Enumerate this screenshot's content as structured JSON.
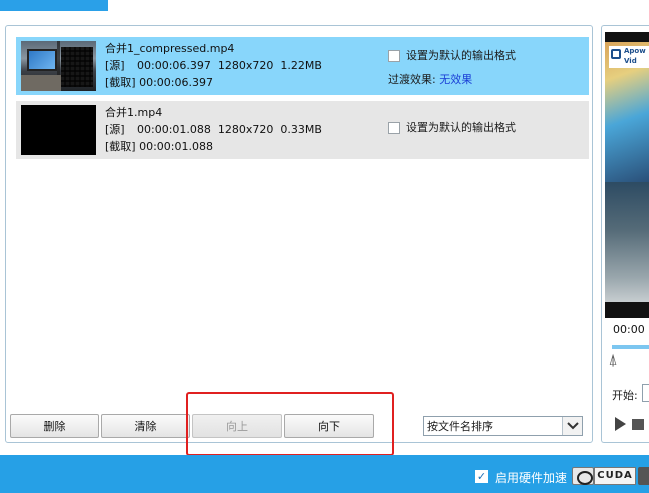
{
  "files": [
    {
      "name": "合并1_compressed.mp4",
      "source_label": "[源]",
      "source_duration": "00:00:06.397",
      "resolution": "1280x720",
      "size": "1.22MB",
      "clip_label": "[截取]",
      "clip_duration": "00:00:06.397",
      "default_format_label": "设置为默认的输出格式",
      "transition_label": "过渡效果:",
      "transition_value": "无效果",
      "selected": true
    },
    {
      "name": "合并1.mp4",
      "source_label": "[源]",
      "source_duration": "00:00:01.088",
      "resolution": "1280x720",
      "size": "0.33MB",
      "clip_label": "[截取]",
      "clip_duration": "00:00:01.088",
      "default_format_label": "设置为默认的输出格式",
      "selected": false
    }
  ],
  "toolbar": {
    "delete_label": "删除",
    "clear_label": "清除",
    "move_up_label": "向上",
    "move_down_label": "向下",
    "sort_value": "按文件名排序"
  },
  "preview": {
    "logo_text": "Apow Vid",
    "time": "00:00",
    "start_label": "开始:",
    "progress": 0.02
  },
  "footer": {
    "hw_accel_label": "启用硬件加速",
    "hw_accel_checked": true,
    "cuda_label": "CUDA"
  },
  "colors": {
    "accent": "#26a0e6",
    "selected_row": "#88d6fb",
    "highlight": "#e02020",
    "link": "#1a3fd6"
  }
}
